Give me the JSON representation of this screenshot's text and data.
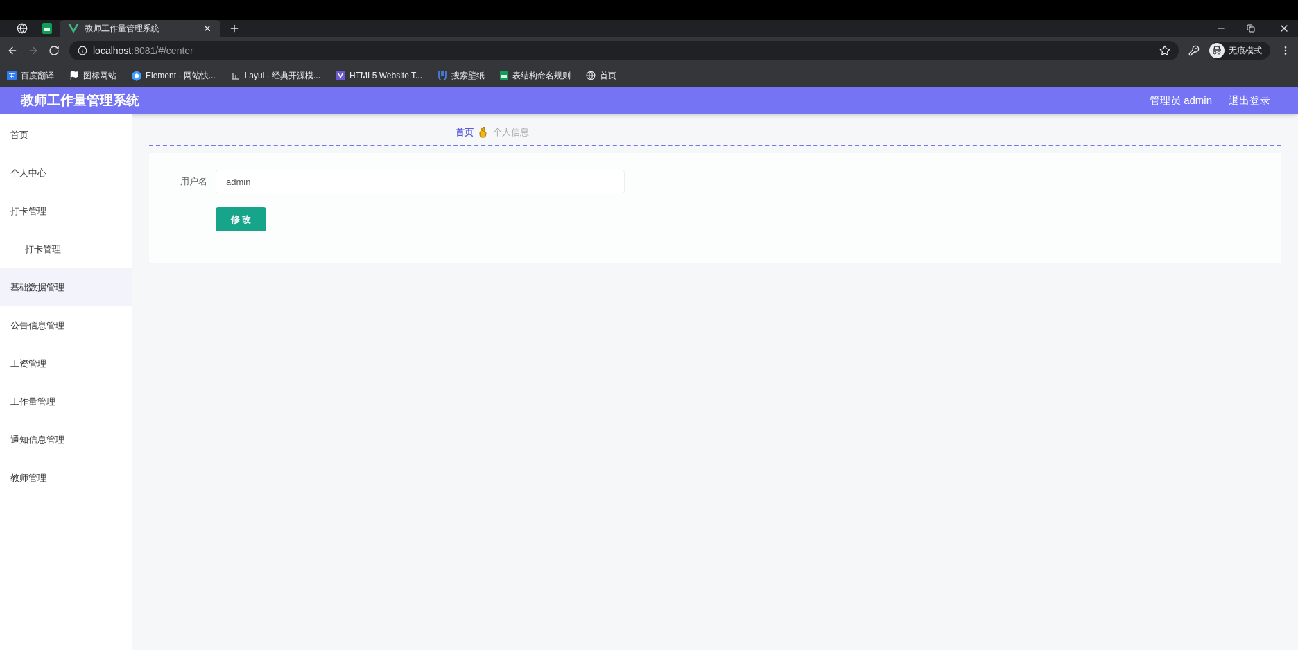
{
  "browser": {
    "tabs": [
      {
        "kind": "globe",
        "selected": false
      },
      {
        "kind": "sheet",
        "selected": false
      },
      {
        "kind": "vue",
        "title": "教师工作量管理系统",
        "selected": true
      }
    ],
    "address": {
      "host": "localhost",
      "rest": ":8081/#/center"
    },
    "profile": "无痕模式",
    "bookmarks": [
      {
        "kind": "translate",
        "label": "百度翻译"
      },
      {
        "kind": "flag",
        "label": "图标网站"
      },
      {
        "kind": "hexagon",
        "label": "Element - 网站快..."
      },
      {
        "kind": "layui",
        "label": "Layui - 经典开源模..."
      },
      {
        "kind": "html5",
        "label": "HTML5 Website T..."
      },
      {
        "kind": "wallpaper",
        "label": "搜索壁纸"
      },
      {
        "kind": "sheet",
        "label": "表结构命名规则"
      },
      {
        "kind": "globe",
        "label": "首页"
      }
    ]
  },
  "header": {
    "title": "教师工作量管理系统",
    "user": "管理员 admin",
    "logout": "退出登录"
  },
  "sidebar": {
    "items": [
      {
        "label": "首页",
        "selected": false
      },
      {
        "label": "个人中心",
        "selected": false
      },
      {
        "label": "打卡管理",
        "selected": false,
        "children": [
          {
            "label": "打卡管理",
            "selected": false
          }
        ]
      },
      {
        "label": "基础数据管理",
        "selected": true
      },
      {
        "label": "公告信息管理",
        "selected": false
      },
      {
        "label": "工资管理",
        "selected": false
      },
      {
        "label": "工作量管理",
        "selected": false
      },
      {
        "label": "通知信息管理",
        "selected": false
      },
      {
        "label": "教师管理",
        "selected": false
      }
    ]
  },
  "breadcrumb": [
    {
      "label": "首页",
      "kind": "link"
    },
    {
      "label": "个人信息",
      "kind": "current"
    }
  ],
  "form": {
    "fields": [
      {
        "label": "用户名",
        "value": "admin"
      }
    ],
    "button": "修 改"
  }
}
